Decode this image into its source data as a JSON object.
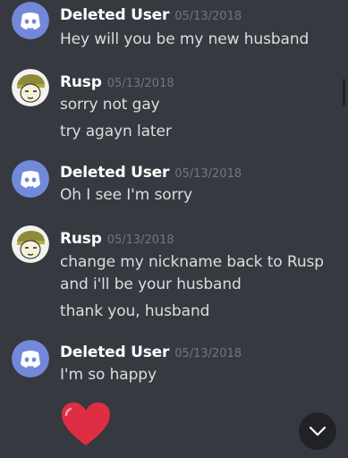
{
  "messages": [
    {
      "author": "Deleted User",
      "timestamp": "05/13/2018",
      "avatar_icon": "discord-logo-icon",
      "lines": [
        "Hey will you be my new husband"
      ]
    },
    {
      "author": "Rusp",
      "timestamp": "05/13/2018",
      "avatar_icon": "rusp-avatar-icon",
      "lines": [
        "sorry not gay",
        "try agayn later"
      ]
    },
    {
      "author": "Deleted User",
      "timestamp": "05/13/2018",
      "avatar_icon": "discord-logo-icon",
      "lines": [
        "Oh I see I'm sorry"
      ]
    },
    {
      "author": "Rusp",
      "timestamp": "05/13/2018",
      "avatar_icon": "rusp-avatar-icon",
      "lines": [
        "change my nickname back to Rusp",
        "and i'll be your husband",
        "thank you, husband"
      ]
    },
    {
      "author": "Deleted User",
      "timestamp": "05/13/2018",
      "avatar_icon": "discord-logo-icon",
      "lines": [
        "I'm so happy"
      ],
      "emoji": "heart-emoji"
    }
  ],
  "scroll_button_icon": "chevron-down-icon",
  "colors": {
    "background": "#36393f",
    "discord_blurple": "#7289da",
    "username": "#ffffff",
    "message_text": "#dcddde",
    "timestamp": "#72767d",
    "heart": "#dd2e44"
  }
}
